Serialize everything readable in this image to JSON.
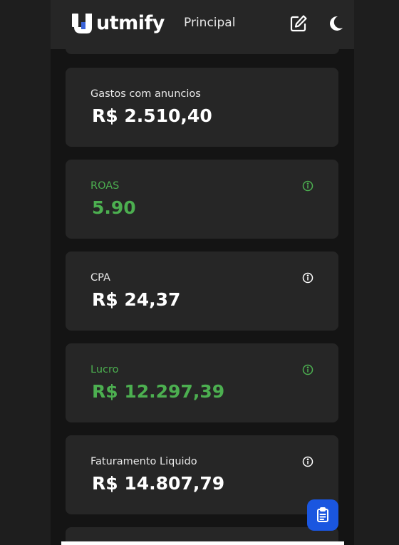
{
  "header": {
    "logo_text": "utmify",
    "title": "Principal",
    "icons": [
      "edit-icon",
      "moon-icon"
    ]
  },
  "cards": [
    {
      "label": "Gastos com anuncios",
      "value": "R$ 2.510,40",
      "info": false,
      "color": "#ffffff"
    },
    {
      "label": "ROAS",
      "value": "5.90",
      "info": true,
      "color": "#4caf50"
    },
    {
      "label": "CPA",
      "value": "R$ 24,37",
      "info": true,
      "color": "#ffffff"
    },
    {
      "label": "Lucro",
      "value": "R$ 12.297,39",
      "info": true,
      "color": "#4caf50"
    },
    {
      "label": "Faturamento Liquido",
      "value": "R$ 14.807,79",
      "info": true,
      "color": "#ffffff"
    }
  ],
  "fab": {
    "icon": "clipboard-icon",
    "color": "#1a56e0"
  },
  "colors": {
    "background": "#141414",
    "card": "#262626",
    "positive": "#4caf50"
  }
}
